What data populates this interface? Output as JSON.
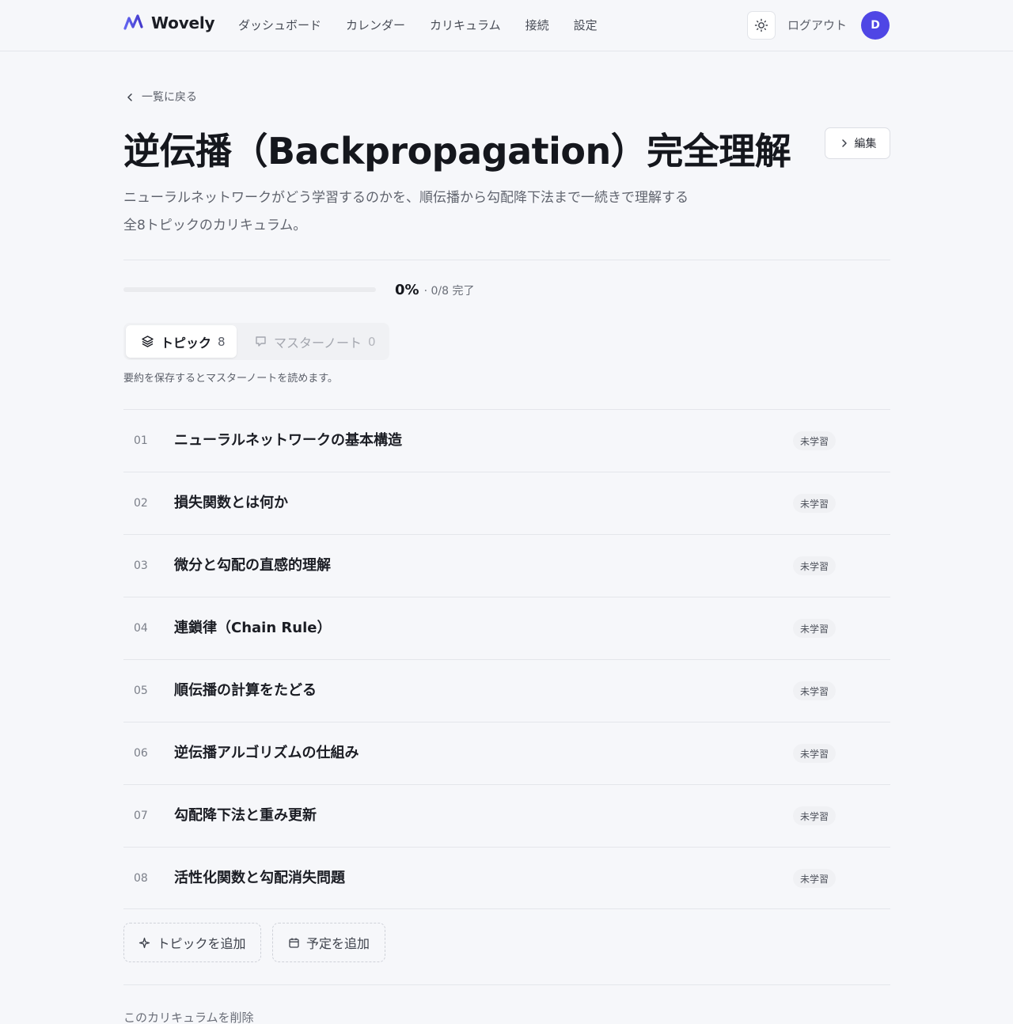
{
  "app": {
    "name": "Wovely",
    "accent_color": "#4f46e5"
  },
  "header": {
    "nav": [
      {
        "label": "ダッシュボード"
      },
      {
        "label": "カレンダー"
      },
      {
        "label": "カリキュラム"
      },
      {
        "label": "接続"
      },
      {
        "label": "設定"
      }
    ],
    "theme_icon": "sun-icon",
    "logout_label": "ログアウト",
    "avatar_initial": "D"
  },
  "page": {
    "back_label": "一覧に戻る",
    "title": "逆伝播（Backpropagation）完全理解",
    "edit_label": "編集",
    "description": "ニューラルネットワークがどう学習するのかを、順伝播から勾配降下法まで一続きで理解する全8トピックのカリキュラム。"
  },
  "progress": {
    "percent_label": "0%",
    "count_label": "· 0/8 完了",
    "fraction": 0
  },
  "tabs": [
    {
      "label": "トピック",
      "count": "8",
      "active": true,
      "icon": "layers-icon"
    },
    {
      "label": "マスターノート",
      "count": "0",
      "active": false,
      "icon": "note-icon"
    }
  ],
  "hint": "要約を保存するとマスターノートを読めます。",
  "topics": [
    {
      "number": "01",
      "title": "ニューラルネットワークの基本構造",
      "status": "未学習"
    },
    {
      "number": "02",
      "title": "損失関数とは何か",
      "status": "未学習"
    },
    {
      "number": "03",
      "title": "微分と勾配の直感的理解",
      "status": "未学習"
    },
    {
      "number": "04",
      "title": "連鎖律（Chain Rule）",
      "status": "未学習"
    },
    {
      "number": "05",
      "title": "順伝播の計算をたどる",
      "status": "未学習"
    },
    {
      "number": "06",
      "title": "逆伝播アルゴリズムの仕組み",
      "status": "未学習"
    },
    {
      "number": "07",
      "title": "勾配降下法と重み更新",
      "status": "未学習"
    },
    {
      "number": "08",
      "title": "活性化関数と勾配消失問題",
      "status": "未学習"
    }
  ],
  "actions": {
    "add_topic_label": "トピックを追加",
    "add_schedule_label": "予定を追加"
  },
  "delete_label": "このカリキュラムを削除"
}
